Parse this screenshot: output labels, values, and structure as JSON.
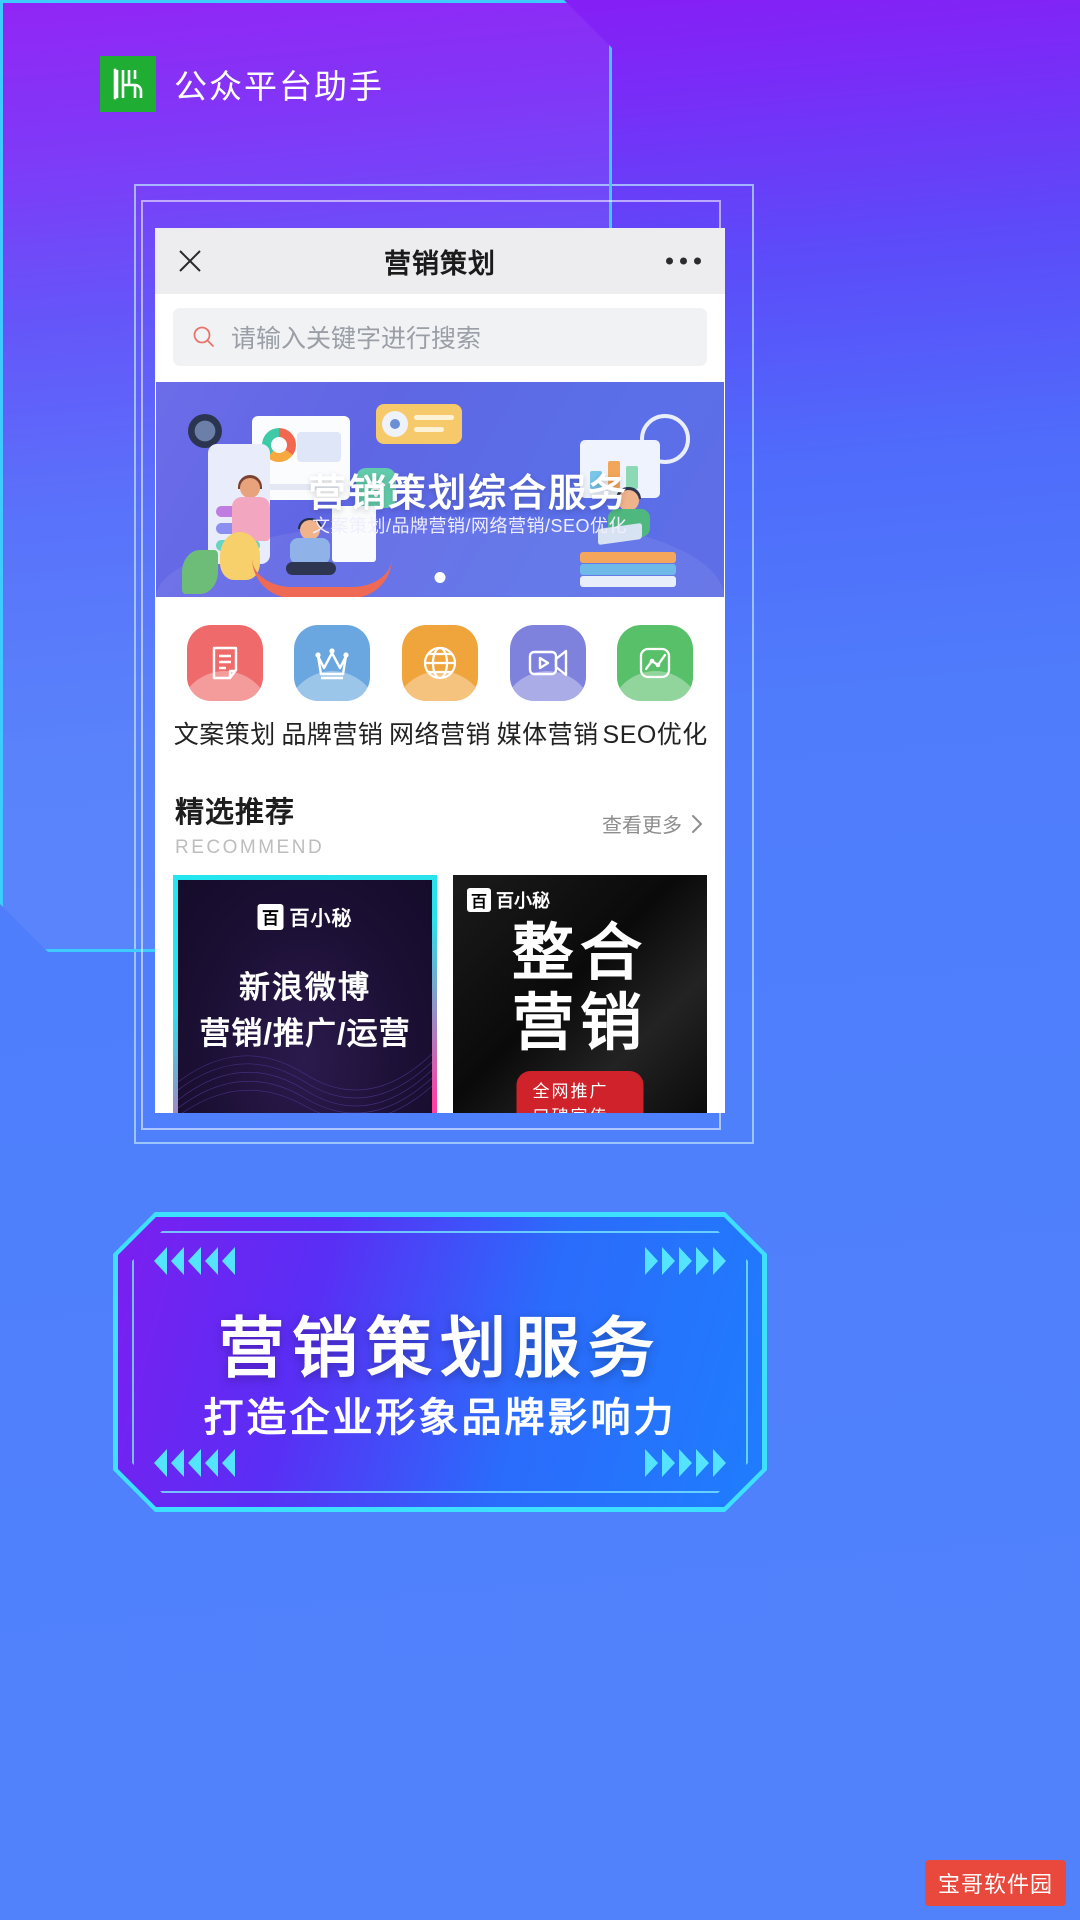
{
  "header": {
    "app_title": "公众平台助手",
    "logo_icon": "wechat-official-logo-icon",
    "logo_color": "#12a828"
  },
  "miniprogram": {
    "close_icon": "close-icon",
    "title": "营销策划",
    "more_icon": "more-options-icon",
    "search": {
      "placeholder": "请输入关键字进行搜索",
      "icon": "search-icon",
      "icon_color": "#e8756b",
      "value": ""
    },
    "banner": {
      "title": "营销策划综合服务",
      "subtitle": "文案策划/品牌营销/网络营销/SEO优化",
      "indicator_count": 1,
      "active_index": 0
    },
    "categories": [
      {
        "label": "文案策划",
        "icon": "document-icon",
        "color": "#ef6a6a"
      },
      {
        "label": "品牌营销",
        "icon": "crown-icon",
        "color": "#6aa7e0"
      },
      {
        "label": "网络营销",
        "icon": "globe-icon",
        "color": "#f0a53c"
      },
      {
        "label": "媒体营销",
        "icon": "video-camera-icon",
        "color": "#7f82dd"
      },
      {
        "label": "SEO优化",
        "icon": "line-chart-icon",
        "color": "#59c06a"
      }
    ],
    "recommend": {
      "title_cn": "精选推荐",
      "title_en": "RECOMMEND",
      "more_label": "查看更多",
      "more_icon": "chevron-right-icon",
      "cards": [
        {
          "brand": "百小秘",
          "brand_mark": "百",
          "line1": "新浪微博",
          "line2": "营销/推广/运营"
        },
        {
          "brand": "百小秘",
          "brand_mark": "百",
          "line1": "整合",
          "line2": "营销",
          "badge": "全网推广 口碑宣传"
        }
      ]
    }
  },
  "bottom_banner": {
    "title": "营销策划服务",
    "subtitle": "打造企业形象品牌影响力",
    "chevron_icon": "chevron-decoration-icon"
  },
  "watermark": {
    "text": "宝哥软件园",
    "color": "#e8493c"
  }
}
